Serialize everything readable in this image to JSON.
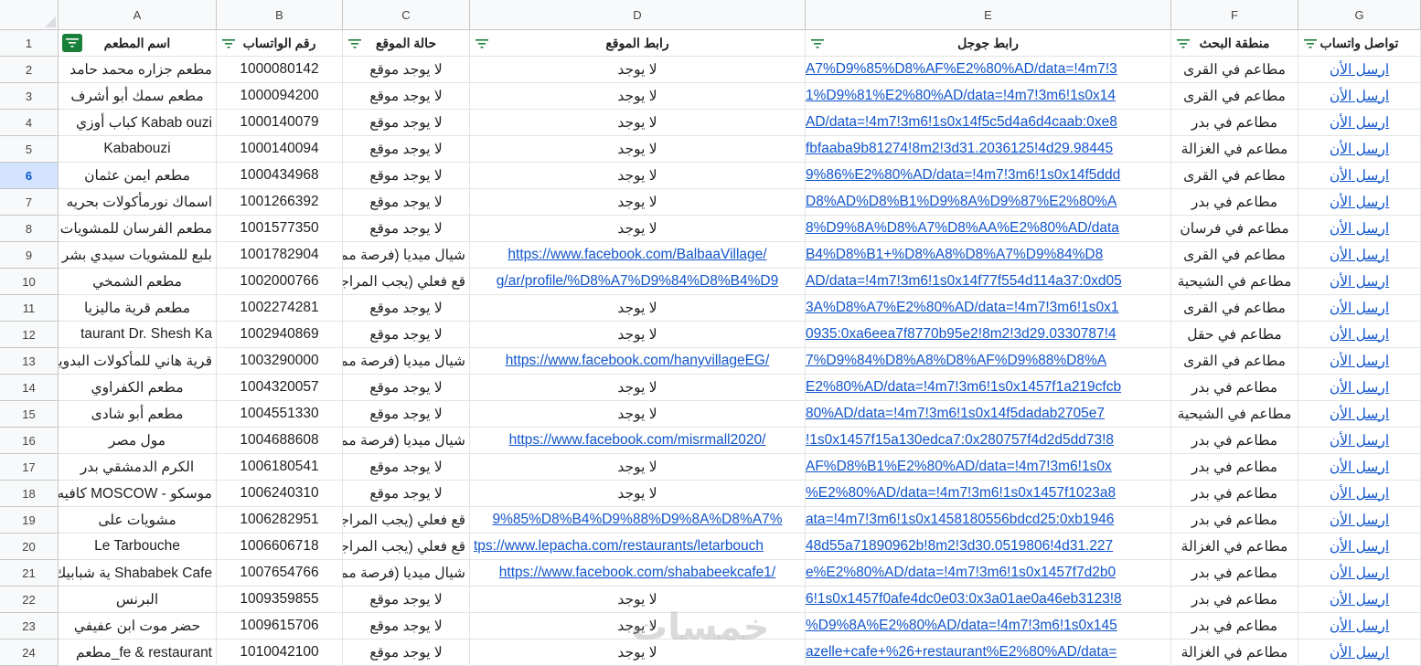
{
  "columns": [
    {
      "letter": "A",
      "header": "اسم المطعم",
      "align": "center"
    },
    {
      "letter": "B",
      "header": "رقم الواتساب",
      "align": "center"
    },
    {
      "letter": "C",
      "header": "حالة الموقع",
      "align": "center"
    },
    {
      "letter": "D",
      "header": "رابط الموقع",
      "align": "center"
    },
    {
      "letter": "E",
      "header": "رابط جوجل",
      "align": "left"
    },
    {
      "letter": "F",
      "header": "منطقة البحث",
      "align": "center"
    },
    {
      "letter": "G",
      "header": "تواصل واتساب",
      "align": "center"
    }
  ],
  "header_row_number": "1",
  "selected_row": "6",
  "filter_icon": "filter-icon",
  "accent_color": "#188038",
  "link_color": "#1155cc",
  "watermark_text": "خمسات",
  "rows": [
    {
      "num": "2",
      "name": "مطعم جزاره محمد حامد",
      "phone": "1000080142",
      "status": "لا يوجد موقع",
      "site": "لا يوجد",
      "site_link": false,
      "google": "A7%D9%85%D8%AF%E2%80%AD/data=!4m7!3",
      "area": "مطاعم في القرى",
      "wa": "ارسل الأن"
    },
    {
      "num": "3",
      "name": "مطعم سمك أبو أشرف",
      "phone": "1000094200",
      "status": "لا يوجد موقع",
      "site": "لا يوجد",
      "site_link": false,
      "google": "1%D9%81%E2%80%AD/data=!4m7!3m6!1s0x14",
      "area": "مطاعم في القرى",
      "wa": "ارسل الأن"
    },
    {
      "num": "4",
      "name": "كباب أوزي Kabab ouzi",
      "phone": "1000140079",
      "status": "لا يوجد موقع",
      "site": "لا يوجد",
      "site_link": false,
      "google": "AD/data=!4m7!3m6!1s0x14f5c5d4a6d4caab:0xe8",
      "area": "مطاعم في بدر",
      "wa": "ارسل الأن"
    },
    {
      "num": "5",
      "name": "Kababouzi",
      "phone": "1000140094",
      "status": "لا يوجد موقع",
      "site": "لا يوجد",
      "site_link": false,
      "google": "fbfaaba9b81274!8m2!3d31.2036125!4d29.98445",
      "area": "مطاعم في الغزالة",
      "wa": "ارسل الأن"
    },
    {
      "num": "6",
      "name": "مطعم ايمن عثمان",
      "phone": "1000434968",
      "status": "لا يوجد موقع",
      "site": "لا يوجد",
      "site_link": false,
      "google": "9%86%E2%80%AD/data=!4m7!3m6!1s0x14f5ddd",
      "area": "مطاعم في القرى",
      "wa": "ارسل الأن"
    },
    {
      "num": "7",
      "name": "اسماك نورمأكولات بحريه",
      "phone": "1001266392",
      "status": "لا يوجد موقع",
      "site": "لا يوجد",
      "site_link": false,
      "google": "D8%AD%D8%B1%D9%8A%D9%87%E2%80%A",
      "area": "مطاعم في بدر",
      "wa": "ارسل الأن"
    },
    {
      "num": "8",
      "name": "مطعم الفرسان للمشويات",
      "phone": "1001577350",
      "status": "لا يوجد موقع",
      "site": "لا يوجد",
      "site_link": false,
      "google": "8%D9%8A%D8%A7%D8%AA%E2%80%AD/data",
      "area": "مطاعم في فرسان",
      "wa": "ارسل الأن"
    },
    {
      "num": "9",
      "name": "بلبع للمشويات سيدي بشر بالس",
      "phone": "1001782904",
      "status": "شيال ميديا (فرصة ممتاز",
      "site": "https://www.facebook.com/BalbaaVillage/",
      "site_link": true,
      "google": "B4%D8%B1+%D8%A8%D8%A7%D9%84%D8",
      "area": "مطاعم في القرى",
      "wa": "ارسل الأن"
    },
    {
      "num": "10",
      "name": "مطعم الشمخي",
      "phone": "1002000766",
      "status": "قع فعلي (يجب المراجع",
      "site": "g/ar/profile/%D8%A7%D9%84%D8%B4%D9",
      "site_link": true,
      "google": "AD/data=!4m7!3m6!1s0x14f77f554d114a37:0xd05",
      "area": "مطاعم في الشيحية",
      "wa": "ارسل الأن"
    },
    {
      "num": "11",
      "name": "مطعم قرية ماليزيا",
      "phone": "1002274281",
      "status": "لا يوجد موقع",
      "site": "لا يوجد",
      "site_link": false,
      "google": "3A%D8%A7%E2%80%AD/data=!4m7!3m6!1s0x1",
      "area": "مطاعم في القرى",
      "wa": "ارسل الأن"
    },
    {
      "num": "12",
      "name": "taurant Dr. Shesh Ka",
      "phone": "1002940869",
      "status": "لا يوجد موقع",
      "site": "لا يوجد",
      "site_link": false,
      "google": "0935:0xa6eea7f8770b95e2!8m2!3d29.0330787!4",
      "area": "مطاعم في حقل",
      "wa": "ارسل الأن"
    },
    {
      "num": "13",
      "name": "قرية هاني للمأكولات البدوية",
      "phone": "1003290000",
      "status": "شيال ميديا (فرصة ممتاز",
      "site": "https://www.facebook.com/hanyvillageEG/",
      "site_link": true,
      "google": "7%D9%84%D8%A8%D8%AF%D9%88%D8%A",
      "area": "مطاعم في القرى",
      "wa": "ارسل الأن"
    },
    {
      "num": "14",
      "name": "مطعم الكفراوي",
      "phone": "1004320057",
      "status": "لا يوجد موقع",
      "site": "لا يوجد",
      "site_link": false,
      "google": "E2%80%AD/data=!4m7!3m6!1s0x1457f1a219cfcb",
      "area": "مطاعم في بدر",
      "wa": "ارسل الأن"
    },
    {
      "num": "15",
      "name": "مطعم أبو شادى",
      "phone": "1004551330",
      "status": "لا يوجد موقع",
      "site": "لا يوجد",
      "site_link": false,
      "google": "80%AD/data=!4m7!3m6!1s0x14f5dadab2705e7",
      "area": "مطاعم في الشيحية",
      "wa": "ارسل الأن"
    },
    {
      "num": "16",
      "name": "مول مصر",
      "phone": "1004688608",
      "status": "شيال ميديا (فرصة ممتاز",
      "site": "https://www.facebook.com/misrmall2020/",
      "site_link": true,
      "google": "!1s0x1457f15a130edca7:0x280757f4d2d5dd73!8",
      "area": "مطاعم في بدر",
      "wa": "ارسل الأن"
    },
    {
      "num": "17",
      "name": "الكرم الدمشقي بدر",
      "phone": "1006180541",
      "status": "لا يوجد موقع",
      "site": "لا يوجد",
      "site_link": false,
      "google": "AF%D8%B1%E2%80%AD/data=!4m7!3m6!1s0x",
      "area": "مطاعم في بدر",
      "wa": "ارسل الأن"
    },
    {
      "num": "18",
      "name": "كافيه MOSCOW - موسكو",
      "phone": "1006240310",
      "status": "لا يوجد موقع",
      "site": "لا يوجد",
      "site_link": false,
      "google": "%E2%80%AD/data=!4m7!3m6!1s0x1457f1023a8",
      "area": "مطاعم في بدر",
      "wa": "ارسل الأن"
    },
    {
      "num": "19",
      "name": "مشويات على",
      "phone": "1006282951",
      "status": "قع فعلي (يجب المراجع",
      "site": "9%85%D8%B4%D9%88%D9%8A%D8%A7%",
      "site_link": true,
      "google": "ata=!4m7!3m6!1s0x1458180556bdcd25:0xb1946",
      "area": "مطاعم في بدر",
      "wa": "ارسل الأن"
    },
    {
      "num": "20",
      "name": "Le Tarbouche",
      "phone": "1006606718",
      "status": "قع فعلي (يجب المراجع",
      "site": "tps://www.lepacha.com/restaurants/letarbouch",
      "site_link": true,
      "google": "48d55a71890962b!8m2!3d30.0519806!4d31.227",
      "area": "مطاعم في الغزالة",
      "wa": "ارسل الأن"
    },
    {
      "num": "21",
      "name": "ية شبابيك Shababek Cafe",
      "phone": "1007654766",
      "status": "شيال ميديا (فرصة ممتاز",
      "site": "https://www.facebook.com/shababeekcafe1/",
      "site_link": true,
      "google": "e%E2%80%AD/data=!4m7!3m6!1s0x1457f7d2b0",
      "area": "مطاعم في بدر",
      "wa": "ارسل الأن"
    },
    {
      "num": "22",
      "name": "البرنس",
      "phone": "1009359855",
      "status": "لا يوجد موقع",
      "site": "لا يوجد",
      "site_link": false,
      "google": "6!1s0x1457f0afe4dc0e03:0x3a01ae0a46eb3123!8",
      "area": "مطاعم في بدر",
      "wa": "ارسل الأن"
    },
    {
      "num": "23",
      "name": "حضر موت ابن عفيفي",
      "phone": "1009615706",
      "status": "لا يوجد موقع",
      "site": "لا يوجد",
      "site_link": false,
      "google": "%D9%8A%E2%80%AD/data=!4m7!3m6!1s0x145",
      "area": "مطاعم في بدر",
      "wa": "ارسل الأن"
    },
    {
      "num": "24",
      "name": "مطعم_fe & restaurant",
      "phone": "1010042100",
      "status": "لا يوجد موقع",
      "site": "لا يوجد",
      "site_link": false,
      "google": "azelle+cafe+%26+restaurant%E2%80%AD/data=",
      "area": "مطاعم في الغزالة",
      "wa": "ارسل الأن"
    }
  ]
}
